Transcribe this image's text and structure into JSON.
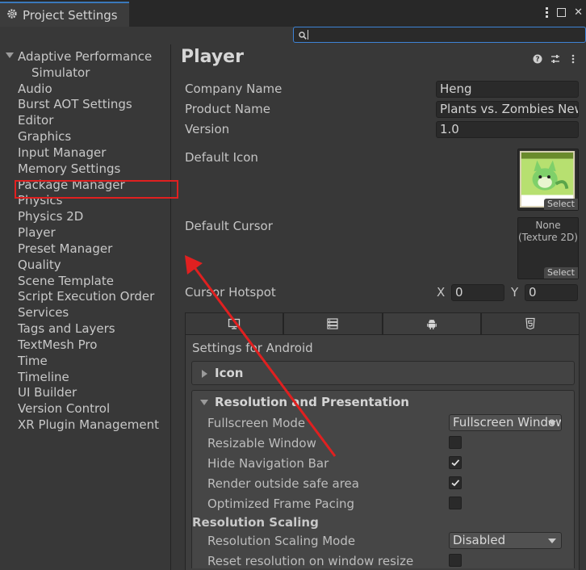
{
  "window": {
    "title": "Project Settings"
  },
  "search": {
    "placeholder": ""
  },
  "sidebar": {
    "items": [
      {
        "label": "Adaptive Performance",
        "expanded": true
      },
      {
        "label": "Simulator"
      },
      {
        "label": "Audio"
      },
      {
        "label": "Burst AOT Settings"
      },
      {
        "label": "Editor"
      },
      {
        "label": "Graphics"
      },
      {
        "label": "Input Manager"
      },
      {
        "label": "Memory Settings"
      },
      {
        "label": "Package Manager"
      },
      {
        "label": "Physics"
      },
      {
        "label": "Physics 2D"
      },
      {
        "label": "Player",
        "selected": true
      },
      {
        "label": "Preset Manager"
      },
      {
        "label": "Quality"
      },
      {
        "label": "Scene Template"
      },
      {
        "label": "Script Execution Order"
      },
      {
        "label": "Services"
      },
      {
        "label": "Tags and Layers"
      },
      {
        "label": "TextMesh Pro"
      },
      {
        "label": "Time"
      },
      {
        "label": "Timeline"
      },
      {
        "label": "UI Builder"
      },
      {
        "label": "Version Control"
      },
      {
        "label": "XR Plugin Management"
      }
    ]
  },
  "main": {
    "title": "Player",
    "company_name_label": "Company Name",
    "company_name_value": "Heng",
    "product_name_label": "Product Name",
    "product_name_value": "Plants vs. Zombies New",
    "version_label": "Version",
    "version_value": "1.0",
    "default_icon_label": "Default Icon",
    "default_icon_select": "Select",
    "default_cursor_label": "Default Cursor",
    "default_cursor_none": "None",
    "default_cursor_type": "(Texture 2D)",
    "default_cursor_select": "Select",
    "cursor_hotspot_label": "Cursor Hotspot",
    "hotspot_x_label": "X",
    "hotspot_x_value": "0",
    "hotspot_y_label": "Y",
    "hotspot_y_value": "0",
    "platform_tabs": [
      {
        "icon": "monitor-icon"
      },
      {
        "icon": "server-icon"
      },
      {
        "icon": "android-icon",
        "active": true
      },
      {
        "icon": "html5-icon"
      }
    ],
    "settings_for": "Settings for Android",
    "sections": {
      "icon": "Icon",
      "resolution": "Resolution and Presentation"
    },
    "resolution": {
      "fullscreen_mode_label": "Fullscreen Mode",
      "fullscreen_mode_value": "Fullscreen Window",
      "resizable_window_label": "Resizable Window",
      "resizable_window_checked": false,
      "hide_nav_bar_label": "Hide Navigation Bar",
      "hide_nav_bar_checked": true,
      "render_safe_area_label": "Render outside safe area",
      "render_safe_area_checked": true,
      "optimized_pacing_label": "Optimized Frame Pacing",
      "optimized_pacing_checked": false,
      "scaling_header": "Resolution Scaling",
      "scaling_mode_label": "Resolution Scaling Mode",
      "scaling_mode_value": "Disabled",
      "reset_on_resize_label": "Reset resolution on window resize",
      "reset_on_resize_checked": false
    }
  },
  "annotation": {
    "color": "#e02020"
  }
}
